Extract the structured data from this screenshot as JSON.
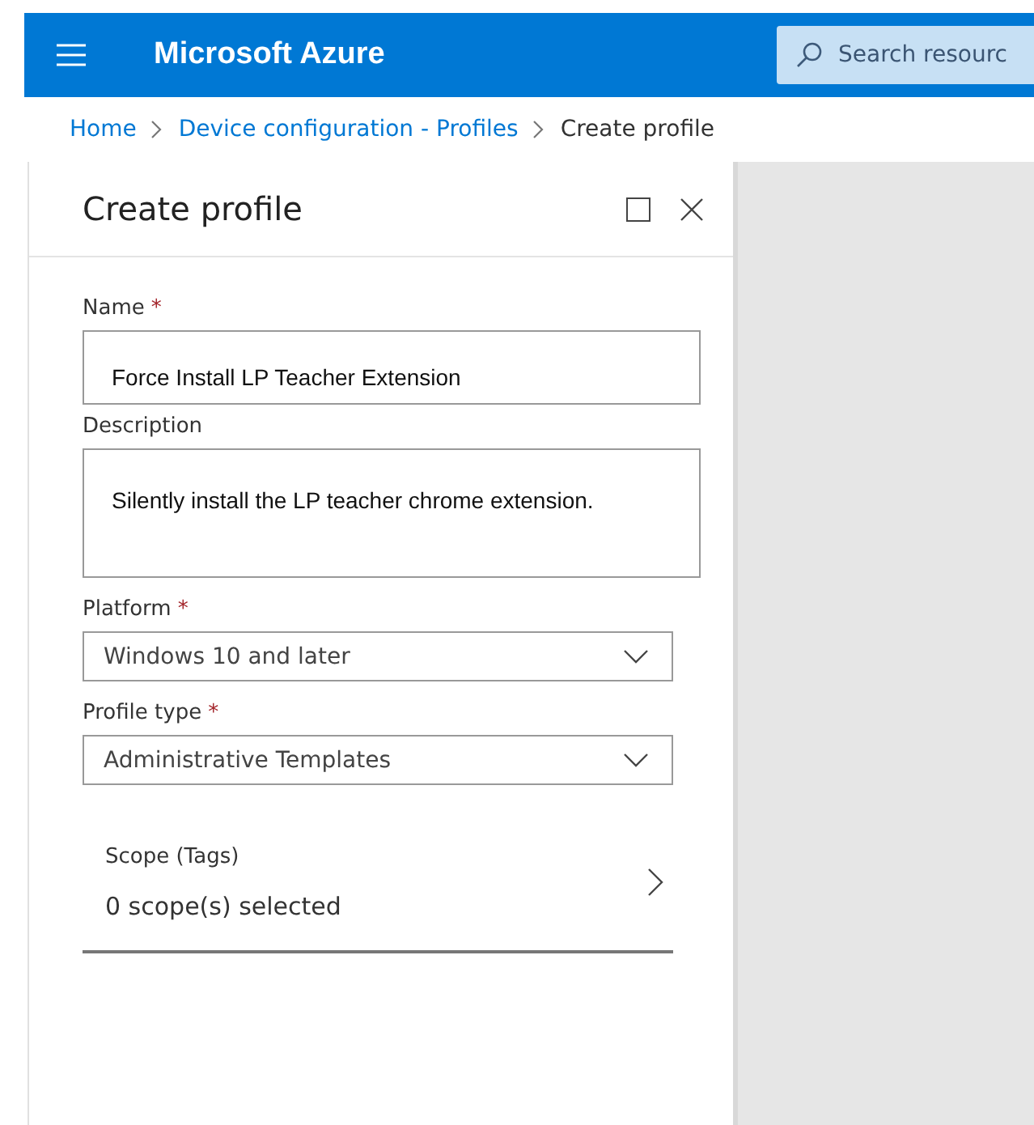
{
  "header": {
    "title": "Microsoft Azure",
    "search": {
      "placeholder": "Search resourc"
    }
  },
  "breadcrumb": [
    {
      "label": "Home",
      "link": true
    },
    {
      "label": "Device configuration - Profiles",
      "link": true
    },
    {
      "label": "Create profile",
      "link": false
    }
  ],
  "panel": {
    "title": "Create profile",
    "fields": [
      {
        "kind": "text",
        "label": "Name",
        "asterisk": "*",
        "value": "Force Install LP Teacher Extension"
      },
      {
        "kind": "textarea",
        "label": "Description",
        "value": "Silently install the LP teacher chrome extension."
      },
      {
        "kind": "dropdown",
        "label": "Platform",
        "asterisk": "*",
        "value": "Windows 10 and later"
      },
      {
        "kind": "dropdown",
        "label": "Profile type",
        "asterisk": "*",
        "value": "Administrative Templates"
      },
      {
        "kind": "picker",
        "label": "Scope (Tags)",
        "value": "0 scope(s) selected"
      }
    ]
  }
}
